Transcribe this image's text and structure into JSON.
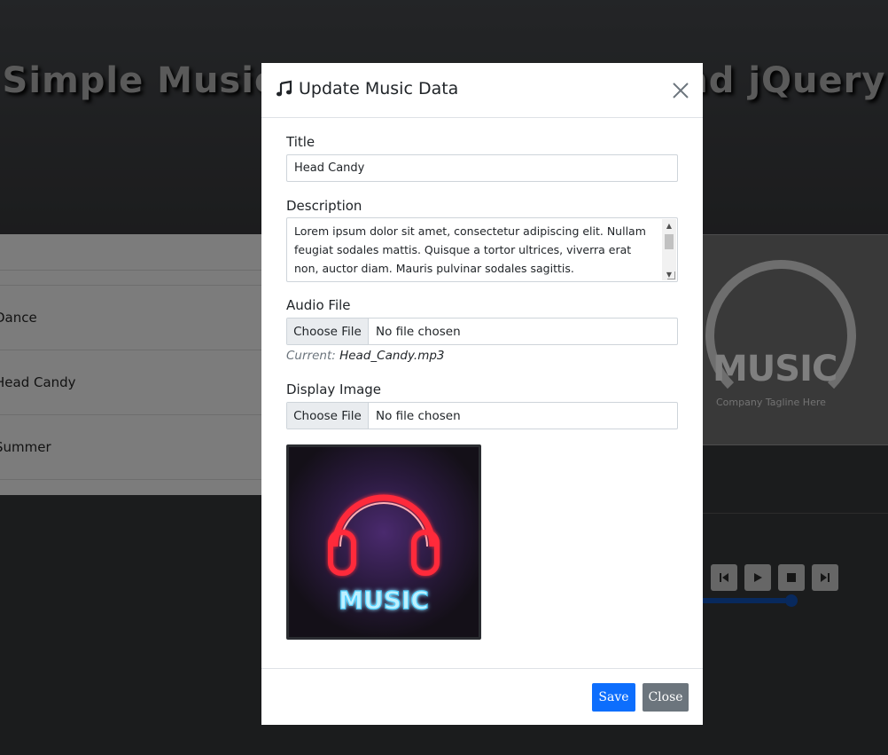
{
  "background": {
    "heading": "Simple Music Player using PHP and jQuery",
    "playlist": [
      "Dance",
      "Head Candy",
      "Summer"
    ],
    "art": {
      "word": "MUSIC",
      "tagline": "Company Tagline Here"
    },
    "controls": [
      "previous-icon",
      "play-icon",
      "stop-icon",
      "next-icon"
    ],
    "progress_value": 1.0
  },
  "modal": {
    "title": "Update Music Data",
    "title_icon": "music-note-icon",
    "fields": {
      "title_label": "Title",
      "title_value": "Head Candy",
      "description_label": "Description",
      "description_value": "Lorem ipsum dolor sit amet, consectetur adipiscing elit. Nullam feugiat sodales mattis. Quisque a tortor ultrices, viverra erat non, auctor diam. Mauris pulvinar sodales sagittis.",
      "audio_label": "Audio File",
      "audio_button": "Choose File",
      "audio_status": "No file chosen",
      "current_prefix": "Current:",
      "current_file": "Head_Candy.mp3",
      "image_label": "Display Image",
      "image_button": "Choose File",
      "image_status": "No file chosen",
      "image_text": "MUSIC"
    },
    "footer": {
      "save_label": "Save",
      "close_label": "Close"
    }
  },
  "colors": {
    "primary": "#0d6efd",
    "secondary": "#6c757d",
    "neon_red": "#ff2a3a",
    "neon_blue": "#4fd0ff"
  }
}
